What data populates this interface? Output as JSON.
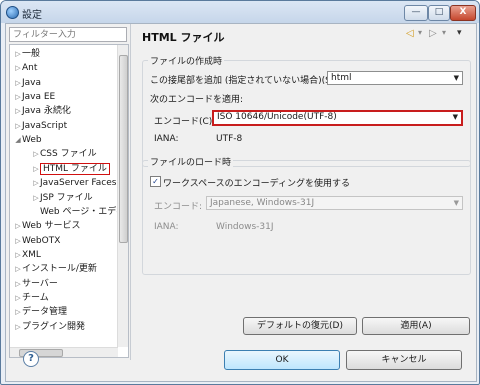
{
  "window": {
    "title": "設定",
    "controls": [
      "—",
      "□",
      "X"
    ]
  },
  "sidebar": {
    "filter_placeholder": "フィルター入力",
    "items": [
      {
        "label": "一般",
        "level": 0,
        "expand": "▷"
      },
      {
        "label": "Ant",
        "level": 0,
        "expand": "▷"
      },
      {
        "label": "Java",
        "level": 0,
        "expand": "▷"
      },
      {
        "label": "Java EE",
        "level": 0,
        "expand": "▷"
      },
      {
        "label": "Java 永続化",
        "level": 0,
        "expand": "▷"
      },
      {
        "label": "JavaScript",
        "level": 0,
        "expand": "▷"
      },
      {
        "label": "Web",
        "level": 0,
        "expand": "◢"
      },
      {
        "label": "CSS ファイル",
        "level": 1,
        "expand": "▷"
      },
      {
        "label": "HTML ファイル",
        "level": 1,
        "expand": "▷",
        "selected": true
      },
      {
        "label": "JavaServer Faces",
        "level": 1,
        "expand": "▷"
      },
      {
        "label": "JSP ファイル",
        "level": 1,
        "expand": "▷"
      },
      {
        "label": "Web ページ・エディ",
        "level": 1,
        "expand": ""
      },
      {
        "label": "Web サービス",
        "level": 0,
        "expand": "▷"
      },
      {
        "label": "WebOTX",
        "level": 0,
        "expand": "▷"
      },
      {
        "label": "XML",
        "level": 0,
        "expand": "▷"
      },
      {
        "label": "インストール/更新",
        "level": 0,
        "expand": "▷"
      },
      {
        "label": "サーバー",
        "level": 0,
        "expand": "▷"
      },
      {
        "label": "チーム",
        "level": 0,
        "expand": "▷"
      },
      {
        "label": "データ管理",
        "level": 0,
        "expand": "▷"
      },
      {
        "label": "プラグイン開発",
        "level": 0,
        "expand": "▷"
      }
    ]
  },
  "page": {
    "title": "HTML ファイル",
    "nav_icons": [
      "◁",
      "▾",
      "▷",
      "▾",
      "▾"
    ],
    "creation_group": {
      "title": "ファイルの作成時",
      "suffix_label": "この接尾部を追加 (指定されていない場合)(S):",
      "suffix_value": "html",
      "encoding_apply_label": "次のエンコードを適用:",
      "encoding_label": "エンコード(C):",
      "encoding_value": "ISO 10646/Unicode(UTF-8)",
      "iana_label": "IANA:",
      "iana_value": "UTF-8"
    },
    "loading_group": {
      "title": "ファイルのロード時",
      "workspace_checkbox_label": "ワークスペースのエンコーディングを使用する",
      "workspace_checked": true,
      "encoding_label": "エンコード:",
      "encoding_value": "Japanese, Windows-31J",
      "iana_label": "IANA:",
      "iana_value": "Windows-31J"
    },
    "restore_button": "デフォルトの復元(D)",
    "apply_button": "適用(A)"
  },
  "footer": {
    "help": "?",
    "ok": "OK",
    "cancel": "キャンセル"
  }
}
